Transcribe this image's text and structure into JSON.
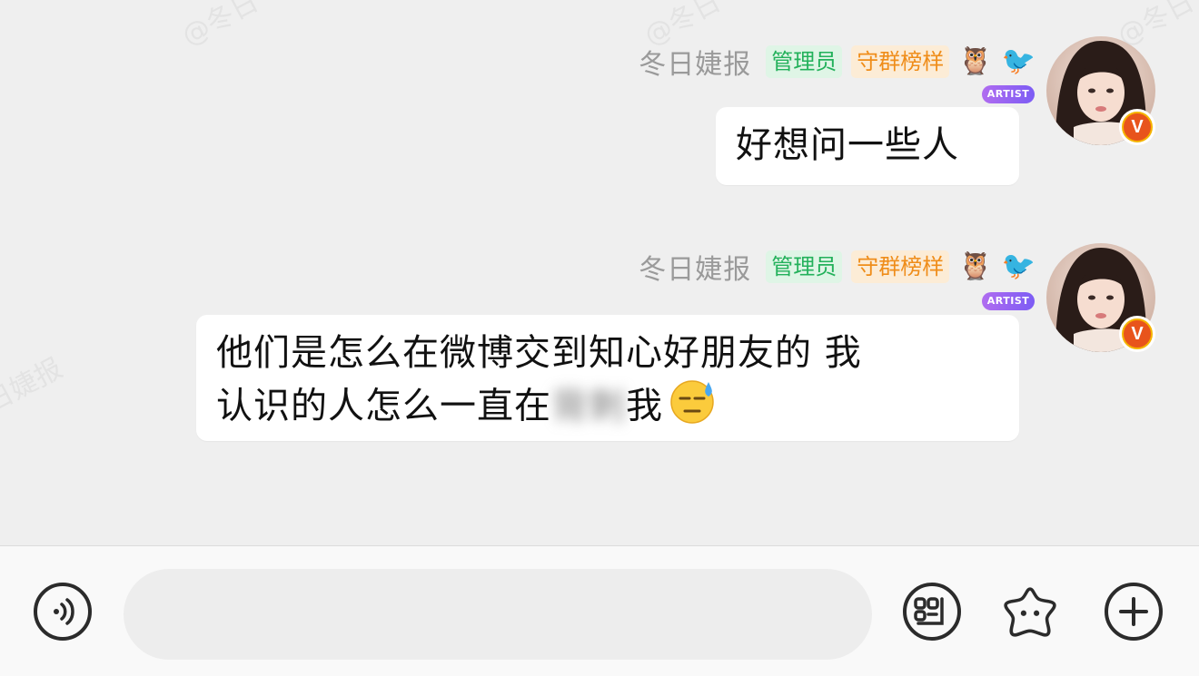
{
  "watermark": {
    "text1": "@冬日",
    "text2": "@冬日",
    "text3": "@冬日",
    "text4": "日婕报"
  },
  "messages": [
    {
      "sender": "冬日婕报",
      "badge_admin": "管理员",
      "badge_role": "守群榜样",
      "owl_icon": "🦉",
      "bird_icon": "🐦",
      "artist_tag": "ARTIST",
      "verified_mark": "V",
      "text": "好想问一些人"
    },
    {
      "sender": "冬日婕报",
      "badge_admin": "管理员",
      "badge_role": "守群榜样",
      "owl_icon": "🦉",
      "bird_icon": "🐦",
      "artist_tag": "ARTIST",
      "verified_mark": "V",
      "line1": "他们是怎么在微博交到知心好朋友的 我",
      "line2_prefix": "认识的人怎么一直在",
      "line2_blurred": "背刺",
      "line2_suffix": "我"
    }
  ],
  "input_bar": {
    "voice_icon": "voice-icon",
    "input_placeholder": "",
    "keyboard_icon": "keyboard-icon",
    "sticker_icon": "sticker-icon",
    "plus_icon": "plus-icon"
  },
  "colors": {
    "background": "#efefef",
    "bubble": "#ffffff",
    "admin_badge_text": "#23b15b",
    "role_badge_text": "#ef8d1a",
    "verify_badge": "#e8541c"
  }
}
